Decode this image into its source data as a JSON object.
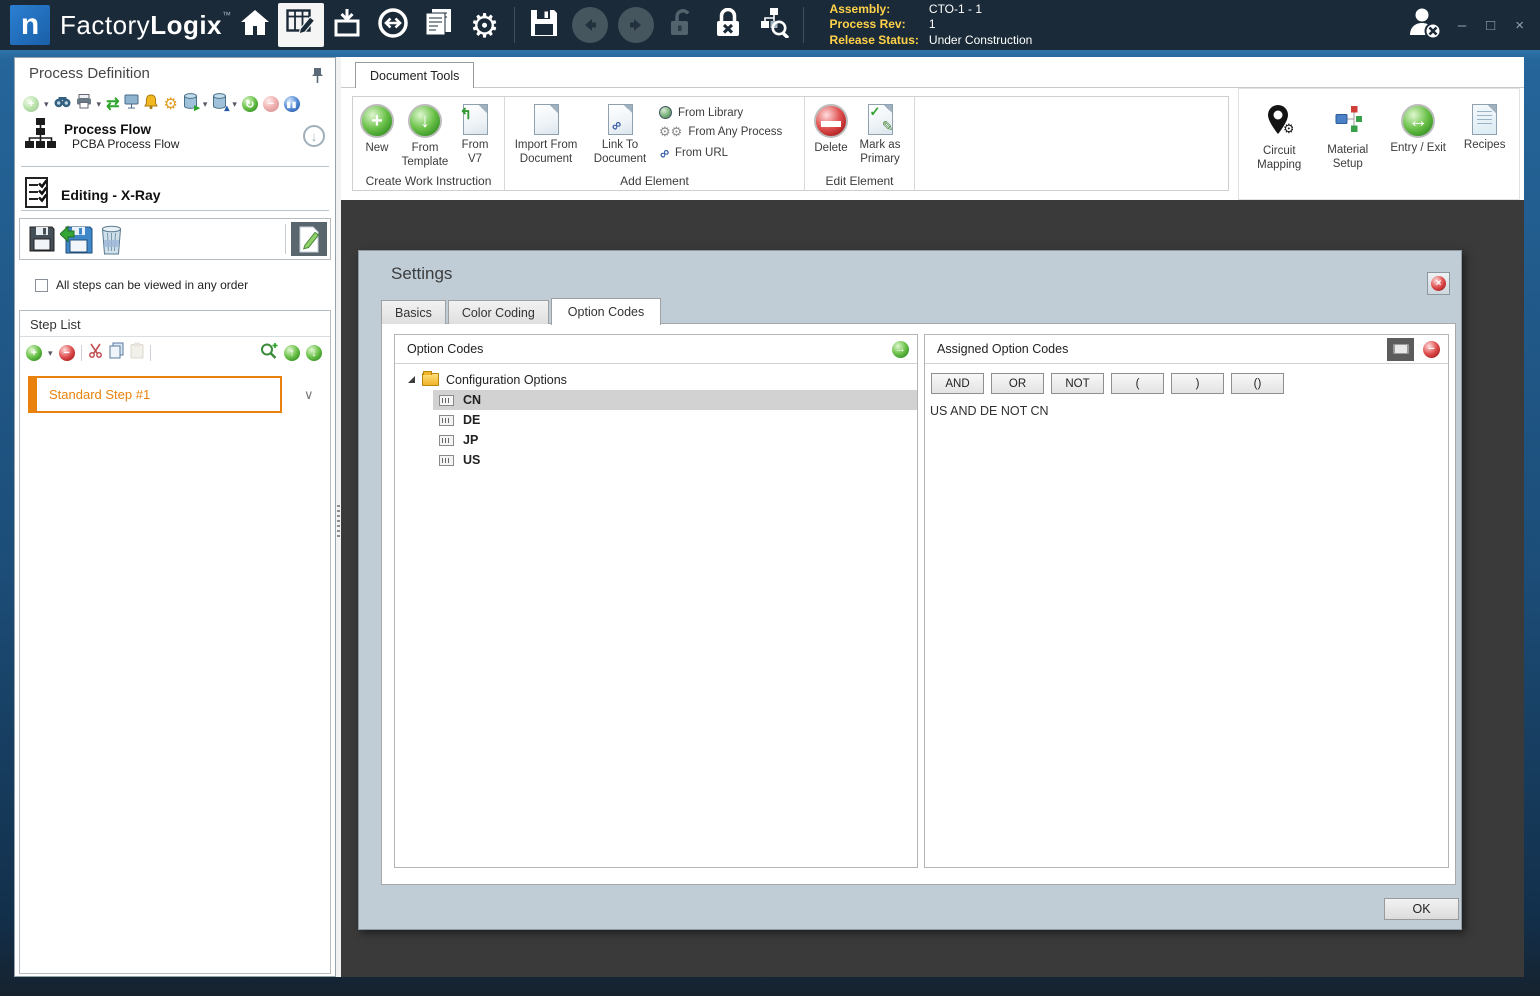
{
  "titlebar": {
    "logo_letter": "n",
    "brand_factory": "Factory",
    "brand_logix": "Logix",
    "brand_tm": "™",
    "info": {
      "assembly_label": "Assembly:",
      "assembly_value": "CTO-1 - 1",
      "rev_label": "Process Rev:",
      "rev_value": "1",
      "status_label": "Release Status:",
      "status_value": "Under Construction"
    },
    "window": {
      "minimize": "–",
      "maximize": "□",
      "close": "×"
    }
  },
  "sidebar": {
    "title": "Process Definition",
    "process_flow": {
      "title": "Process Flow",
      "subtitle": "PCBA Process Flow"
    },
    "editing_title": "Editing - X-Ray",
    "order_checkbox_label": "All steps can be viewed in any order",
    "step_list": {
      "title": "Step List",
      "steps": [
        {
          "label": "Standard Step #1"
        }
      ]
    }
  },
  "ribbon": {
    "tab_label": "Document Tools",
    "groups": [
      {
        "label": "Create Work Instruction",
        "buttons": [
          "New",
          "From Template",
          "From V7"
        ]
      },
      {
        "label": "Add Element",
        "buttons": [
          "Import From Document",
          "Link To Document"
        ],
        "links": [
          "From Library",
          "From Any Process",
          "From URL"
        ]
      },
      {
        "label": "Edit Element",
        "buttons": [
          "Delete",
          "Mark as Primary"
        ]
      }
    ],
    "right_panel": [
      "Circuit Mapping",
      "Material Setup",
      "Entry / Exit",
      "Recipes"
    ]
  },
  "dialog": {
    "title": "Settings",
    "tabs": [
      "Basics",
      "Color Coding",
      "Option Codes"
    ],
    "option_codes": {
      "header": "Option Codes",
      "root_label": "Configuration Options",
      "items": [
        "CN",
        "DE",
        "JP",
        "US"
      ],
      "selected_item": "CN"
    },
    "assigned": {
      "header": "Assigned Option Codes",
      "operators": [
        "AND",
        "OR",
        "NOT",
        "(",
        ")",
        "()"
      ],
      "expression": "US AND DE NOT CN"
    },
    "ok_label": "OK"
  },
  "colors": {
    "accent_orange": "#e8820c",
    "titlebar_bg": "#1a2a38",
    "label_yellow": "#ffd24a",
    "workarea_bg": "#3a3a3a",
    "dialog_bg": "#c0cdd7"
  }
}
